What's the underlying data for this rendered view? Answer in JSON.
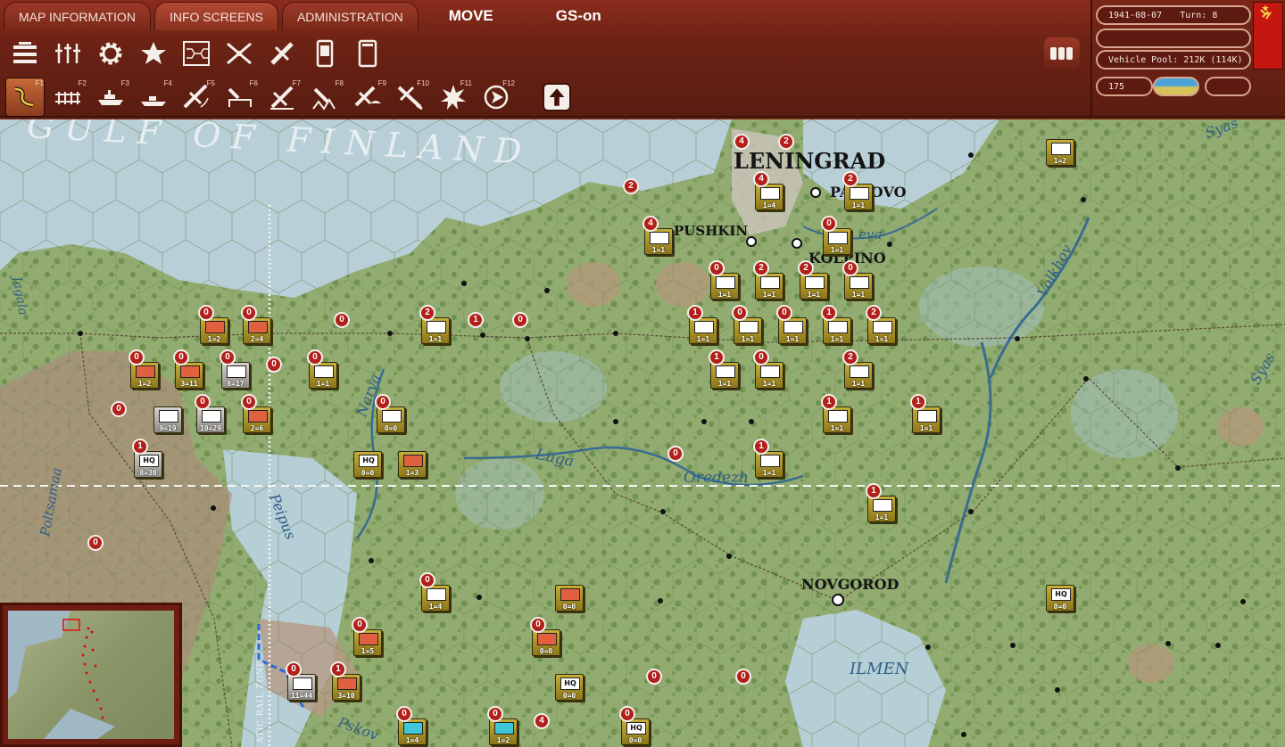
{
  "tabs": [
    "MAP INFORMATION",
    "INFO SCREENS",
    "ADMINISTRATION"
  ],
  "mode": "MOVE",
  "gs_status": "GS-on",
  "toolbar_icons": [
    "unit-list-icon",
    "sliders-icon",
    "settings-gear-icon",
    "star-icon",
    "hex-grid-icon",
    "air-missions-icon",
    "air-supply-icon",
    "phone-icon",
    "tablet-icon"
  ],
  "fkeys": [
    "F1",
    "F2",
    "F3",
    "F4",
    "F5",
    "F6",
    "F7",
    "F8",
    "F9",
    "F10",
    "F11",
    "F12"
  ],
  "panel": {
    "date": "1941-08-07",
    "turn": "Turn: 8",
    "vehicle_pool": "Vehicle Pool: 212K (114K)",
    "value": "175"
  },
  "colors": {
    "soviet_unit": "#b8a033",
    "axis_unit": "#d7d3cc",
    "badge": "#b3201a"
  },
  "map_labels": {
    "gulf": "GULF OF FINLAND",
    "leningrad": "LENINGRAD",
    "pavlovo": "PAVLOVO",
    "pushkin": "PUSHKIN",
    "kolpino": "KOLPINO",
    "novgorod": "NOVGOROD",
    "ilmen": "ILMEN",
    "luga": "Luga",
    "oredezh": "Oredezh",
    "narva": "Narva",
    "peipus": "Peipus",
    "pskov": "Pskov",
    "volkhov": "Volkhov",
    "syas": "Syas",
    "syas2": "Syas",
    "poltsamaa": "Poltsamaa",
    "jagala": "Jagala",
    "neva": "eva",
    "rail_zone": "ATIC RAIL ZONE"
  },
  "units": [
    {
      "s": "1=2",
      "t": "red",
      "side": "sov",
      "b": "0"
    },
    {
      "s": "2=4",
      "t": "red",
      "side": "sov",
      "b": "0"
    },
    {
      "s": "1=2",
      "t": "red",
      "side": "sov",
      "b": "0"
    },
    {
      "s": "3=11",
      "t": "red",
      "side": "sov",
      "b": "0"
    },
    {
      "s": "8=17",
      "t": "white",
      "side": "ger",
      "b": "0"
    },
    {
      "s": "1=1",
      "t": "sym",
      "side": "sov",
      "b": "0"
    },
    {
      "s": "9=19",
      "t": "white",
      "side": "ger",
      "b": ""
    },
    {
      "s": "10=29",
      "t": "white",
      "side": "ger",
      "b": "0"
    },
    {
      "s": "2=6",
      "t": "red",
      "side": "sov",
      "b": "0"
    },
    {
      "s": "8=30",
      "t": "hq",
      "side": "ger",
      "b": "1"
    },
    {
      "s": "0=0",
      "t": "sym",
      "side": "sov",
      "b": "0"
    },
    {
      "s": "0=0",
      "t": "hq",
      "side": "sov",
      "b": ""
    },
    {
      "s": "1=3",
      "t": "red",
      "side": "sov",
      "b": ""
    },
    {
      "s": "1=1",
      "t": "white",
      "side": "sov",
      "b": "2"
    },
    {
      "s": "1=4",
      "t": "white",
      "side": "sov",
      "b": "4"
    },
    {
      "s": "1=1",
      "t": "white",
      "side": "sov",
      "b": "2"
    },
    {
      "s": "1=1",
      "t": "white",
      "side": "sov",
      "b": "4"
    },
    {
      "s": "1=1",
      "t": "white",
      "side": "sov",
      "b": "0"
    },
    {
      "s": "1=1",
      "t": "white",
      "side": "sov",
      "b": "0"
    },
    {
      "s": "1=1",
      "t": "white",
      "side": "sov",
      "b": "2"
    },
    {
      "s": "1=1",
      "t": "white",
      "side": "sov",
      "b": "2"
    },
    {
      "s": "1=1",
      "t": "white",
      "side": "sov",
      "b": "0"
    },
    {
      "s": "1=1",
      "t": "white",
      "side": "sov",
      "b": "1"
    },
    {
      "s": "1=1",
      "t": "white",
      "side": "sov",
      "b": "0"
    },
    {
      "s": "1=1",
      "t": "white",
      "side": "sov",
      "b": "0"
    },
    {
      "s": "1=1",
      "t": "white",
      "side": "sov",
      "b": "1"
    },
    {
      "s": "1=1",
      "t": "white",
      "side": "sov",
      "b": "2"
    },
    {
      "s": "1=1",
      "t": "white",
      "side": "sov",
      "b": "1"
    },
    {
      "s": "1=1",
      "t": "white",
      "side": "sov",
      "b": "0"
    },
    {
      "s": "1=1",
      "t": "white",
      "side": "sov",
      "b": "2"
    },
    {
      "s": "1=1",
      "t": "white",
      "side": "sov",
      "b": "1"
    },
    {
      "s": "1=1",
      "t": "white",
      "side": "sov",
      "b": "1"
    },
    {
      "s": "1=1",
      "t": "white",
      "side": "sov",
      "b": "1"
    },
    {
      "s": "1=1",
      "t": "white",
      "side": "sov",
      "b": "1"
    },
    {
      "s": "1=2",
      "t": "white",
      "side": "sov",
      "b": ""
    },
    {
      "s": "1=4",
      "t": "sym",
      "side": "sov",
      "b": "0"
    },
    {
      "s": "0=0",
      "t": "red",
      "side": "sov",
      "b": ""
    },
    {
      "s": "0=0",
      "t": "red",
      "side": "sov",
      "b": "0"
    },
    {
      "s": "1=5",
      "t": "red",
      "side": "sov",
      "b": "0"
    },
    {
      "s": "11=44",
      "t": "white",
      "side": "ger",
      "b": "0"
    },
    {
      "s": "3=10",
      "t": "red",
      "side": "sov",
      "b": "1"
    },
    {
      "s": "0=0",
      "t": "hq",
      "side": "sov",
      "b": ""
    },
    {
      "s": "0=0",
      "t": "hq",
      "side": "sov",
      "b": ""
    },
    {
      "s": "1=4",
      "t": "cyan",
      "side": "sov",
      "b": "0"
    },
    {
      "s": "1=2",
      "t": "cyan",
      "side": "sov",
      "b": "0"
    },
    {
      "s": "0=0",
      "t": "hq",
      "side": "sov",
      "b": "0"
    }
  ],
  "loose_badges": [
    "0",
    "1",
    "0",
    "0",
    "0",
    "0",
    "0",
    "0",
    "0",
    "4",
    "4",
    "2",
    "2"
  ]
}
